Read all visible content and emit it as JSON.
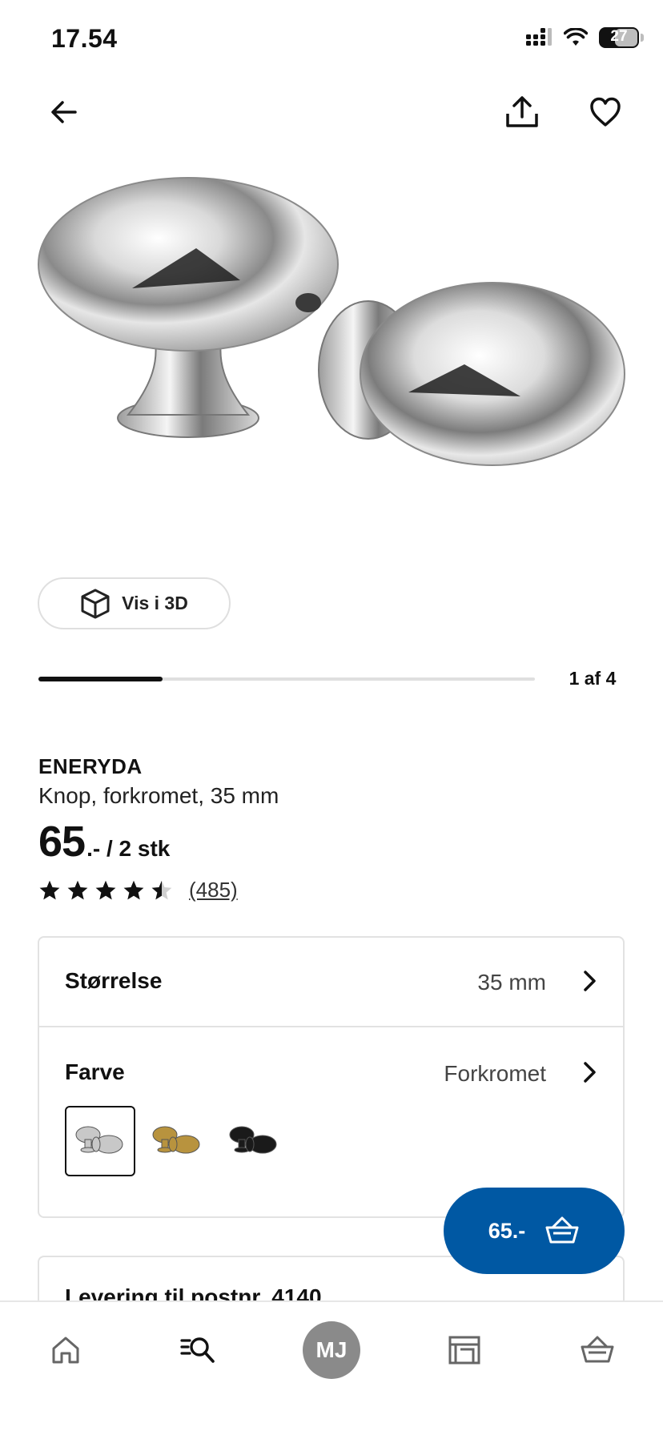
{
  "status_bar": {
    "time": "17.54",
    "battery": "27"
  },
  "top_nav": {
    "back_icon": "arrow-left-icon",
    "share_icon": "share-icon",
    "favorite_icon": "heart-icon"
  },
  "gallery": {
    "view_3d_label": "Vis i 3D",
    "view_3d_icon": "cube-icon",
    "counter": "1 af 4",
    "progress": 0.25
  },
  "product": {
    "name": "ENERYDA",
    "description": "Knop, forkromet, 35 mm",
    "price_main": "65",
    "price_suffix": ".- / 2 stk",
    "rating": 4.5,
    "rating_count": "(485)"
  },
  "options": {
    "size": {
      "label": "Størrelse",
      "value": "35 mm"
    },
    "color": {
      "label": "Farve",
      "value": "Forkromet",
      "swatches": [
        {
          "name": "Forkromet",
          "color": "#c8c8c8",
          "selected": true
        },
        {
          "name": "Messing",
          "color": "#b8933e",
          "selected": false
        },
        {
          "name": "Sort",
          "color": "#1a1a1a",
          "selected": false
        }
      ]
    }
  },
  "delivery": {
    "text": "Levering til postnr. 4140"
  },
  "cart_fab": {
    "label": "65.-",
    "icon": "basket-icon"
  },
  "bottom_nav": {
    "items": [
      {
        "name": "home",
        "icon": "home-icon"
      },
      {
        "name": "search",
        "icon": "search-icon"
      },
      {
        "name": "profile",
        "initials": "MJ"
      },
      {
        "name": "stores",
        "icon": "store-icon"
      },
      {
        "name": "cart",
        "icon": "basket-icon"
      }
    ]
  },
  "colors": {
    "accent": "#0058a3",
    "text": "#111111",
    "border": "#e2e2e2"
  }
}
